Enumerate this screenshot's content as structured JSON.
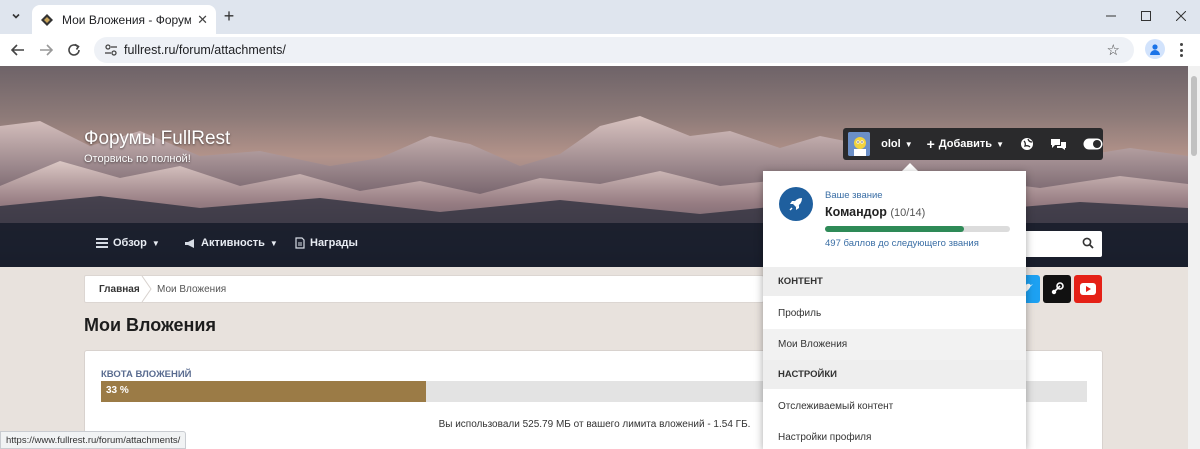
{
  "browser": {
    "tab_title": "Мои Вложения - Форумы FullR",
    "url": "fullrest.ru/forum/attachments/",
    "status_url": "https://www.fullrest.ru/forum/attachments/"
  },
  "site": {
    "title": "Форумы FullRest",
    "subtitle": "Оторвись по полной!"
  },
  "nav": {
    "overview": "Обзор",
    "activity": "Активность",
    "awards": "Награды"
  },
  "userbar": {
    "username": "olol",
    "add_label": "Добавить"
  },
  "breadcrumb": {
    "home": "Главная",
    "current": "Мои Вложения"
  },
  "page": {
    "title": "Мои Вложения"
  },
  "quota": {
    "label": "КВОТА ВЛОЖЕНИЙ",
    "percent_text": "33 %",
    "fraction": 0.33,
    "usage_text": "Вы использовали 525.79 МБ от вашего лимита вложений - 1.54 ГБ."
  },
  "rank": {
    "hint": "Ваше звание",
    "name": "Командор",
    "count": "(10/14)",
    "progress_fraction": 0.75,
    "points_text": "497 баллов до следующего звания"
  },
  "dropdown": {
    "section_content": "КОНТЕНТ",
    "profile": "Профиль",
    "my_attachments": "Мои Вложения",
    "section_settings": "НАСТРОЙКИ",
    "watched": "Отслеживаемый контент",
    "profile_settings": "Настройки профиля"
  },
  "colors": {
    "accent_blue": "#1f5f9e",
    "quota_fill": "#9b7b46",
    "rank_fill": "#2e8a57",
    "youtube": "#e52117",
    "steam": "#111111",
    "twitter": "#1da1f2"
  }
}
